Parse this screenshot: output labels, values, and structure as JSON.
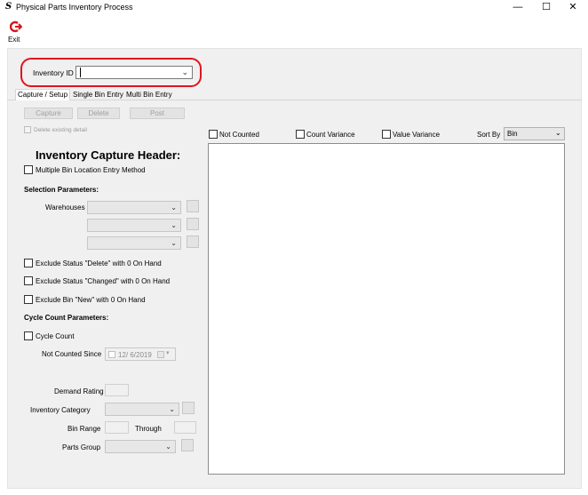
{
  "window": {
    "icon_glyph": "S",
    "title": "Physical Parts Inventory Process",
    "minimize_glyph": "—",
    "maximize_glyph": "☐",
    "close_glyph": "✕"
  },
  "toolbar": {
    "exit_label": "Exit",
    "exit_icon": "exit-arrow-icon"
  },
  "inventory_id": {
    "label": "Inventory ID",
    "value": ""
  },
  "tabs": [
    {
      "label": "Capture / Setup",
      "selected": true
    },
    {
      "label": "Single Bin Entry",
      "selected": false
    },
    {
      "label": "Multi Bin Entry",
      "selected": false
    }
  ],
  "actions": {
    "capture": "Capture",
    "delete": "Delete",
    "post": "Post"
  },
  "delete_existing_detail": "Delete existing detail",
  "header_title": "Inventory Capture Header:",
  "multiple_bin_location": "Multiple Bin Location Entry Method",
  "selection_parameters": "Selection Parameters:",
  "warehouses_label": "Warehouses",
  "exclude": {
    "status_delete": "Exclude Status \"Delete\" with 0 On Hand",
    "status_changed": "Exclude Status \"Changed\" with 0 On Hand",
    "bin_new": "Exclude Bin \"New\" with 0 On Hand"
  },
  "cycle_count_parameters": "Cycle Count Parameters:",
  "cycle_count": "Cycle Count",
  "not_counted_since": {
    "label": "Not Counted Since",
    "value": "12/ 6/2019"
  },
  "demand_rating": "Demand Rating",
  "inventory_category": "Inventory Category",
  "bin_range": {
    "label": "Bin Range",
    "through": "Through"
  },
  "parts_group": "Parts Group",
  "filters": {
    "not_counted": "Not Counted",
    "count_variance": "Count Variance",
    "value_variance": "Value Variance",
    "sort_by_label": "Sort By",
    "sort_by_value": "Bin"
  },
  "colors": {
    "highlight": "#e0141e",
    "exit_icon": "#d9141e"
  }
}
